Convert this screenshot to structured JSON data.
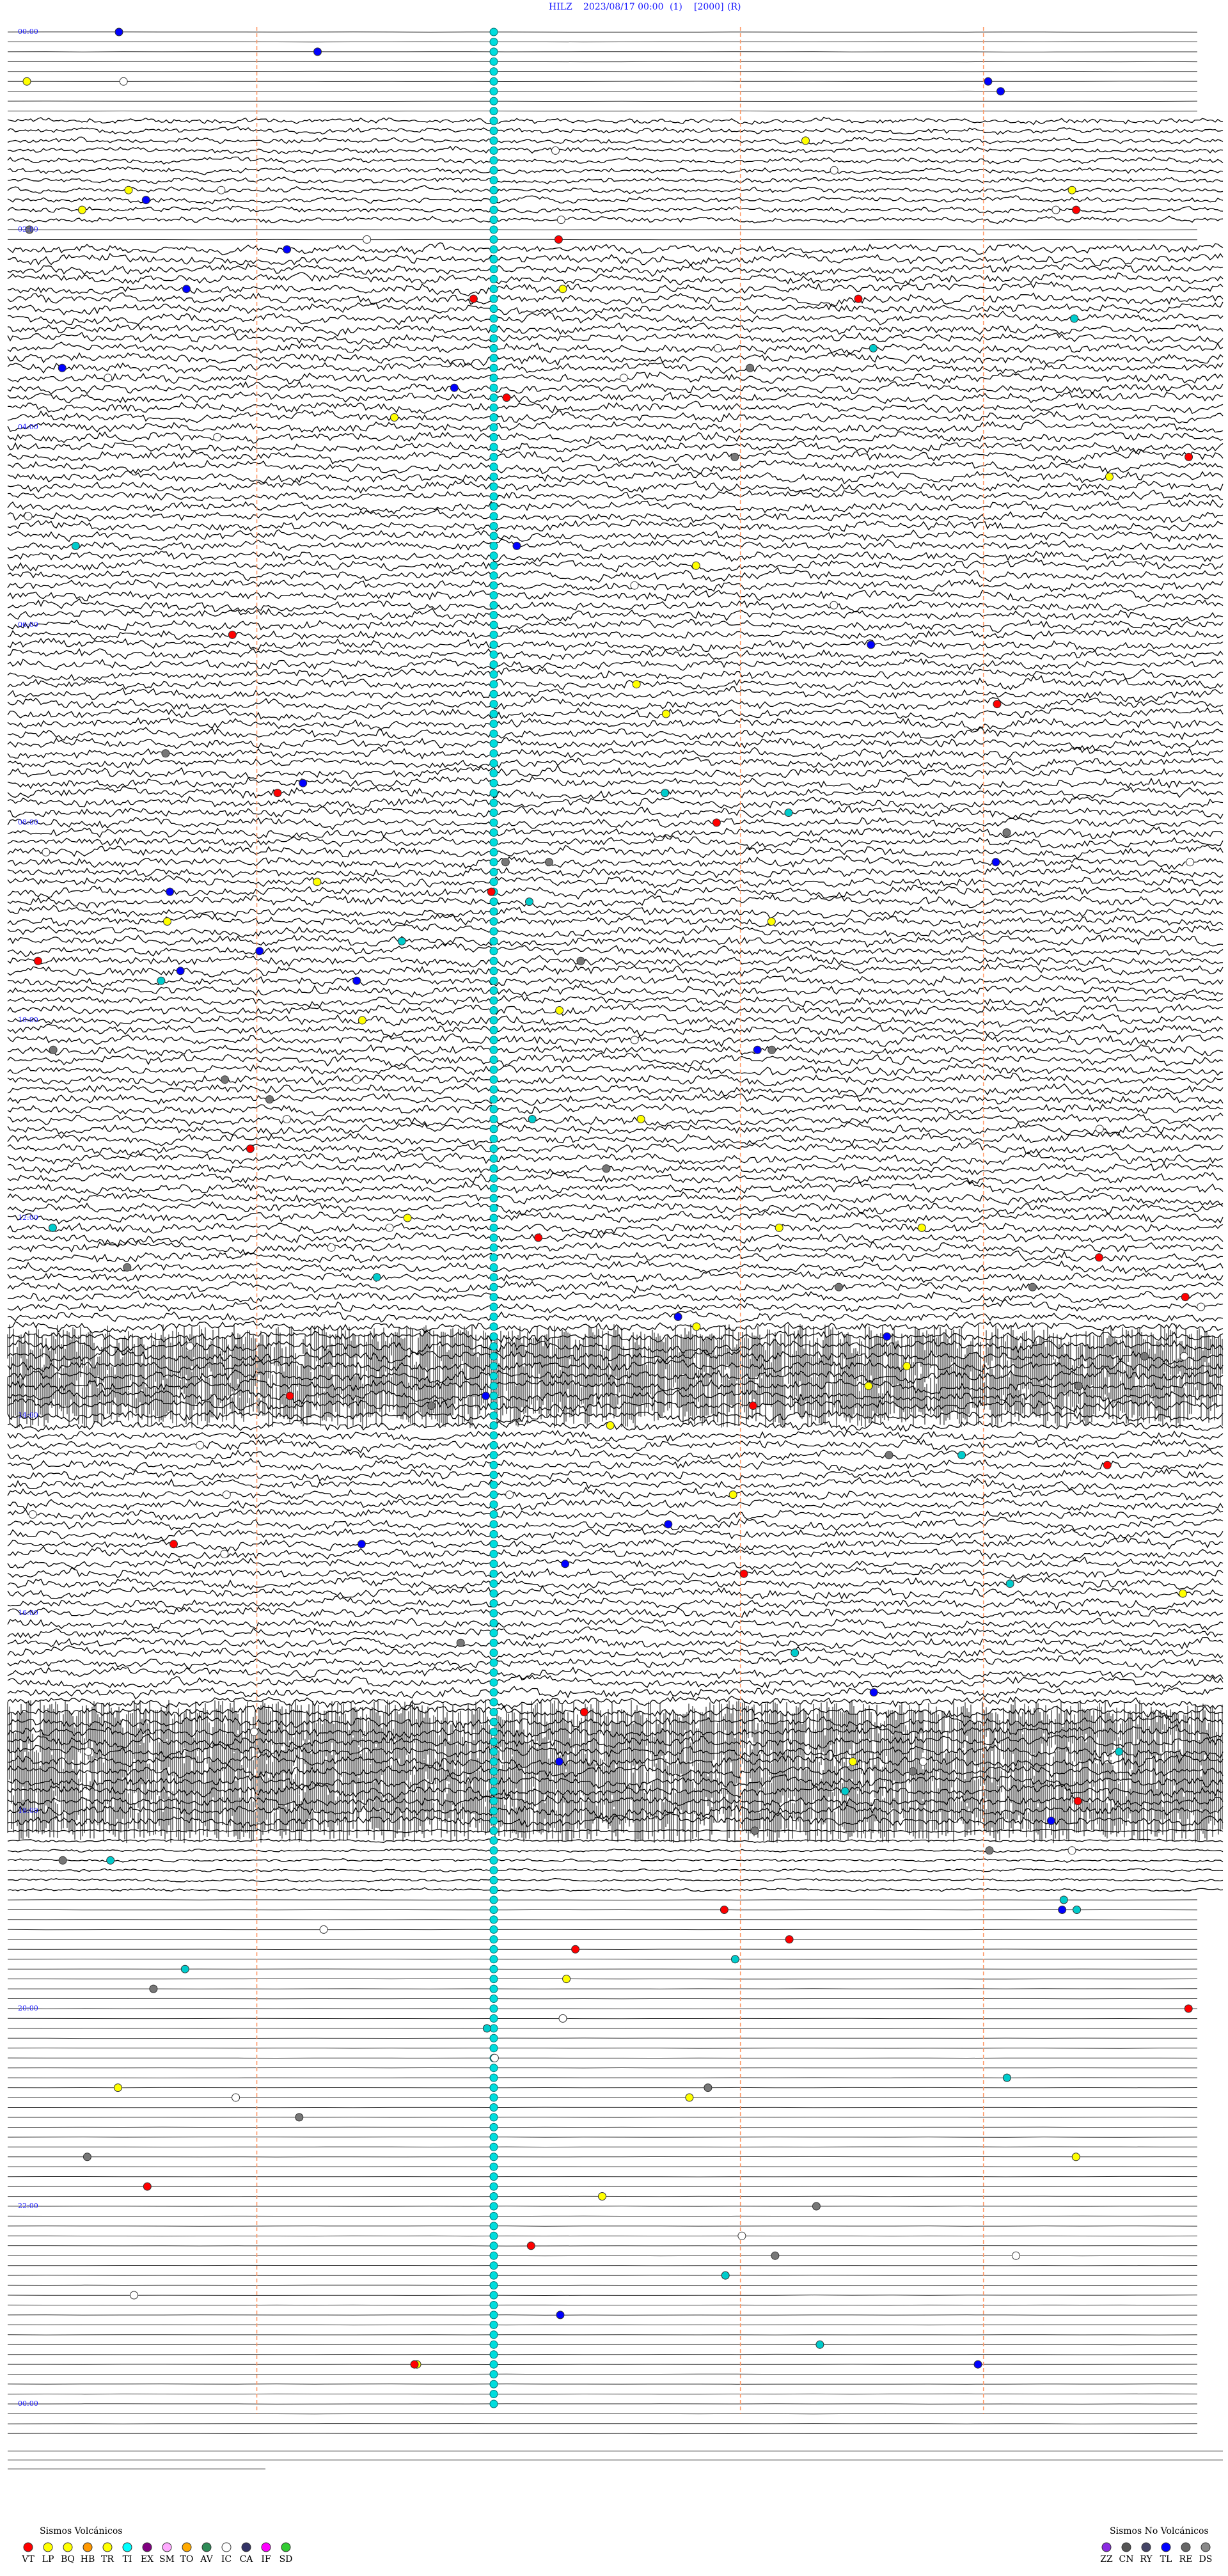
{
  "header": {
    "station": "HILZ",
    "datetime": "2023/08/17 00:00",
    "channel": "(1)",
    "scale": "[2000]",
    "flag": "(R)"
  },
  "chart_data": {
    "type": "helicorder",
    "rows_total": 244,
    "hours": 24,
    "time_labels": [
      "00:00",
      "02:00",
      "04:00",
      "06:00",
      "08:00",
      "10:00",
      "12:00",
      "14:00",
      "16:00",
      "18:00",
      "20:00",
      "22:00",
      "00:00"
    ],
    "time_label_rows": [
      0,
      20,
      40,
      60,
      80,
      100,
      120,
      140,
      160,
      180,
      200,
      220,
      240
    ],
    "dashed_markers_x_fraction": [
      0.205,
      0.603,
      0.803
    ],
    "cyan_marker_column_fraction": 0.4,
    "activity_bands": [
      {
        "row_start": 9,
        "row_end": 20,
        "level": "medium"
      },
      {
        "row_start": 22,
        "row_end": 173,
        "level": "high"
      },
      {
        "row_start": 133,
        "row_end": 140,
        "level": "saturated"
      },
      {
        "row_start": 171,
        "row_end": 182,
        "level": "saturated"
      },
      {
        "row_start": 182,
        "row_end": 189,
        "level": "partial"
      }
    ]
  },
  "legend_volcanic": {
    "title": "Sismos Volcánicos",
    "items": [
      {
        "code": "VT",
        "color": "#ff0000"
      },
      {
        "code": "LP",
        "color": "#ffff00"
      },
      {
        "code": "BQ",
        "color": "#ffff00"
      },
      {
        "code": "HB",
        "color": "#ff9900"
      },
      {
        "code": "TR",
        "color": "#ffff00"
      },
      {
        "code": "TI",
        "color": "#00ffff"
      },
      {
        "code": "EX",
        "color": "#800080"
      },
      {
        "code": "SM",
        "color": "#ffaaff"
      },
      {
        "code": "TO",
        "color": "#ffaa00"
      },
      {
        "code": "AV",
        "color": "#2e8b57"
      },
      {
        "code": "IC",
        "color": "#ffffff"
      },
      {
        "code": "CA",
        "color": "#333366"
      },
      {
        "code": "IF",
        "color": "#ff00ff"
      },
      {
        "code": "SD",
        "color": "#33cc33"
      }
    ]
  },
  "legend_nonvolcanic": {
    "title": "Sismos No Volcánicos",
    "items": [
      {
        "code": "ZZ",
        "color": "#8a2be2"
      },
      {
        "code": "CN",
        "color": "#555555"
      },
      {
        "code": "RY",
        "color": "#444466"
      },
      {
        "code": "TL",
        "color": "#0000ff"
      },
      {
        "code": "RE",
        "color": "#666666"
      },
      {
        "code": "DS",
        "color": "#888888"
      }
    ]
  },
  "colors": {
    "trace": "#000000",
    "flat_trace": "#333333",
    "dashed_marker": "#ff9966",
    "time_label": "#1a1aff",
    "cyan_event": "#00dddd"
  }
}
